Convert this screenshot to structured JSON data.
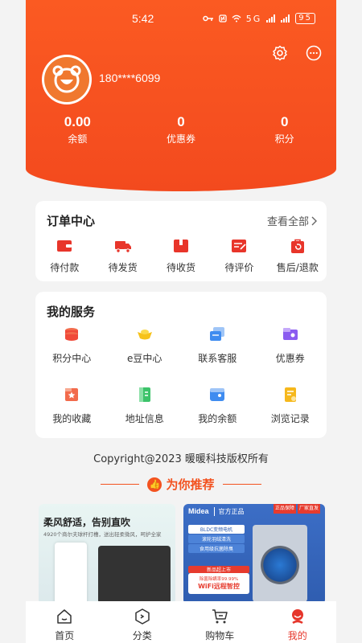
{
  "status_bar": {
    "time": "5:42",
    "icons_text": "5G",
    "battery": "95"
  },
  "profile": {
    "phone": "180****6099"
  },
  "stats": [
    {
      "value": "0.00",
      "label": "余额"
    },
    {
      "value": "0",
      "label": "优惠券"
    },
    {
      "value": "0",
      "label": "积分"
    }
  ],
  "orders": {
    "title": "订单中心",
    "more": "查看全部",
    "items": [
      "待付款",
      "待发货",
      "待收货",
      "待评价",
      "售后/退款"
    ]
  },
  "services": {
    "title": "我的服务",
    "items": [
      "积分中心",
      "e豆中心",
      "联系客服",
      "优惠券",
      "我的收藏",
      "地址信息",
      "我的余额",
      "浏览记录"
    ]
  },
  "copyright": "Copyright@2023 暖暖科技版权所有",
  "recommend": {
    "title": "为你推荐"
  },
  "products": {
    "left": {
      "title": "柔风舒适，告别直吹",
      "subtitle": "4920个商尔夫球杆打槽，送出轻柔微风，呵护全家"
    },
    "right": {
      "brand": "Midea",
      "brand_tag": "官方正品",
      "badges": [
        "正品保障",
        "厂家直发"
      ],
      "features": [
        "BLDC变频电机",
        "滚轮羽绒清洗",
        "食用级抗菌除臭"
      ],
      "promo_top": "新品超上市",
      "promo_line1": "除菌除螨率99.99%",
      "promo_line2": "WiFi远程智控"
    }
  },
  "tabs": [
    {
      "label": "首页"
    },
    {
      "label": "分类"
    },
    {
      "label": "购物车"
    },
    {
      "label": "我的"
    }
  ],
  "colors": {
    "accent": "#f34a1e",
    "active_tab": "#e6352a"
  }
}
